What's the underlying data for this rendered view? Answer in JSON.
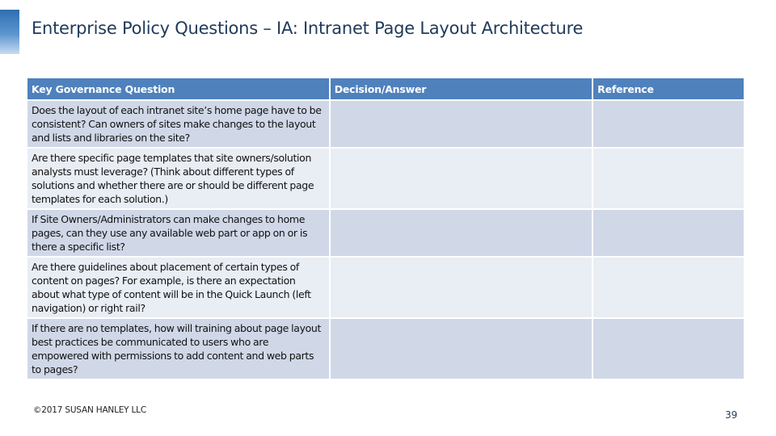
{
  "slide": {
    "title": "Enterprise Policy Questions – IA: Intranet Page Layout Architecture",
    "footer_copyright": "©2017 SUSAN HANLEY LLC",
    "page_number": "39",
    "colors": {
      "header_fill": "#4f81bd",
      "row_odd": "#d0d8e8",
      "row_even": "#e9edf4",
      "title_text": "#1f3a5a"
    }
  },
  "table": {
    "headers": [
      "Key Governance Question",
      "Decision/Answer",
      "Reference"
    ],
    "rows": [
      {
        "question": "Does the layout of each intranet site’s home page have to be consistent? Can owners of sites make changes to the layout and lists and libraries on the site?",
        "decision": "",
        "reference": ""
      },
      {
        "question": "Are there specific page templates that site owners/solution analysts must leverage? (Think about different types of solutions and whether there are or should be different page templates for each solution.)",
        "decision": "",
        "reference": ""
      },
      {
        "question": "If Site Owners/Administrators can make changes to home pages, can they use any available web part or app on or is there a specific list?",
        "decision": "",
        "reference": ""
      },
      {
        "question": "Are there guidelines about placement of certain types of content on pages? For example, is there an expectation about what type of content will be in the Quick Launch (left navigation) or right rail?",
        "decision": "",
        "reference": ""
      },
      {
        "question": "If there are no templates, how will training about page layout best practices be communicated to users who are empowered with permissions to add content and web parts to pages?",
        "decision": "",
        "reference": ""
      }
    ]
  }
}
